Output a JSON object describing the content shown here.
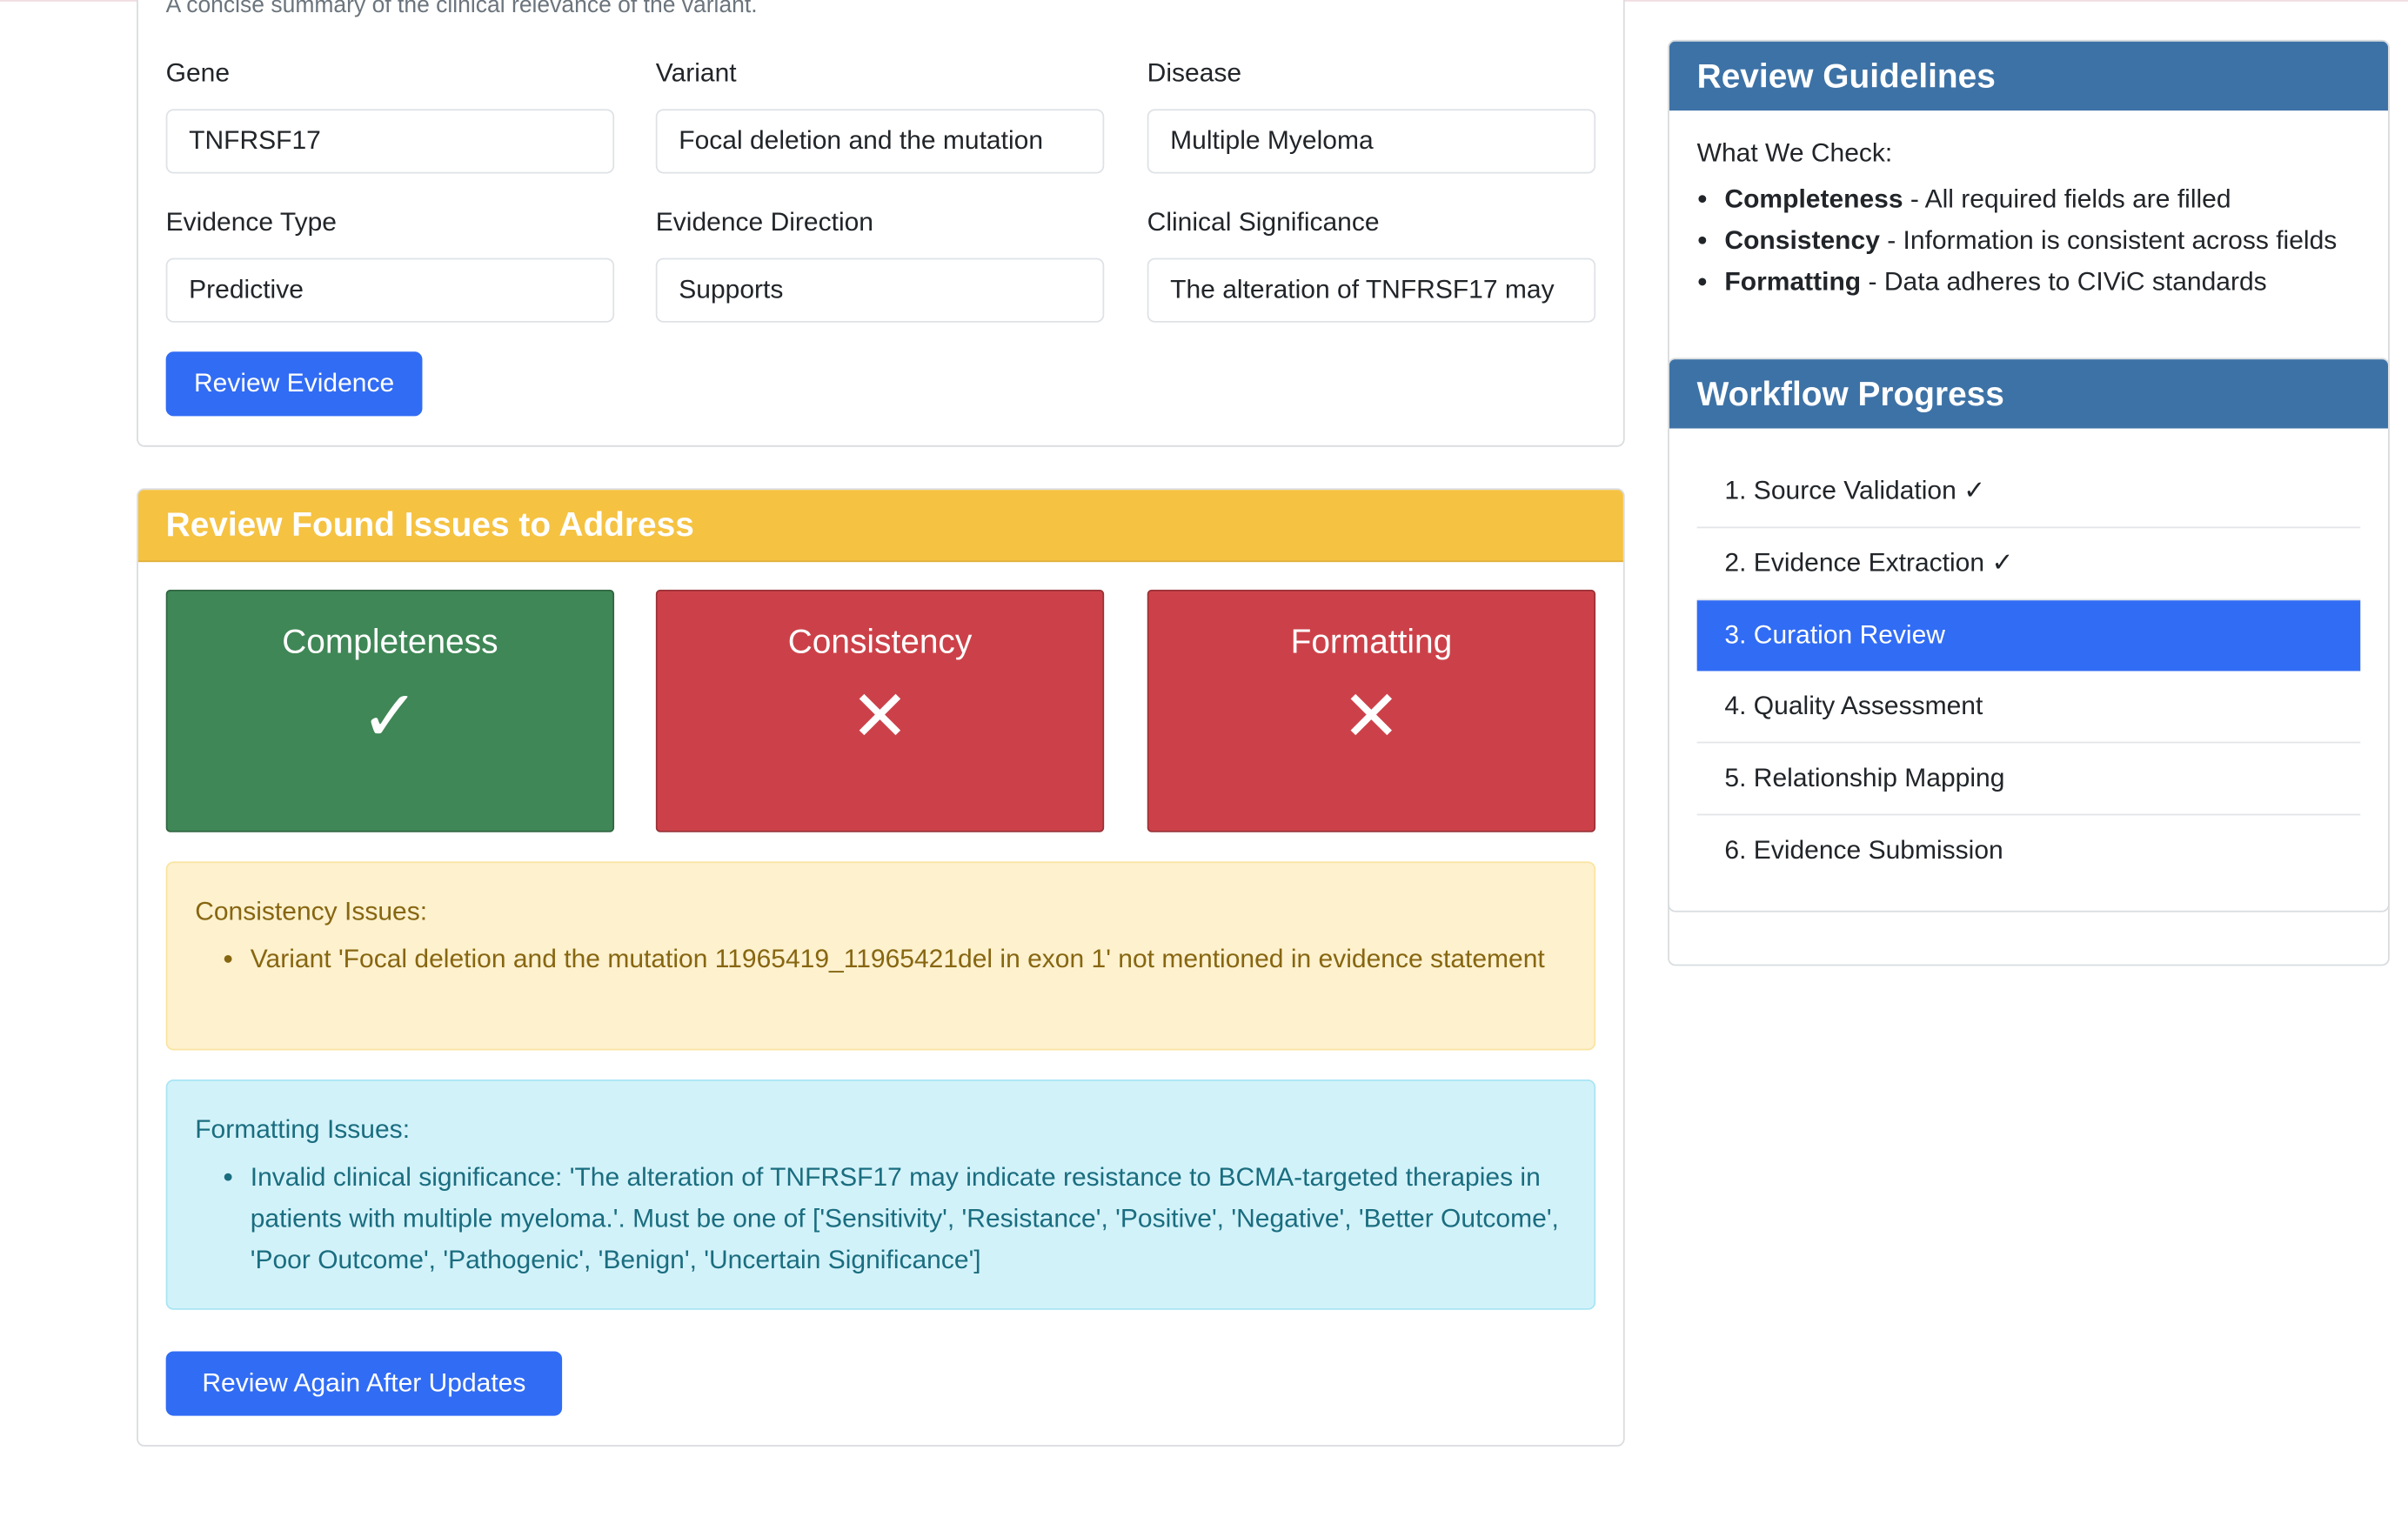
{
  "form": {
    "description": "A concise summary of the clinical relevance of the variant.",
    "fields": [
      {
        "label": "Gene",
        "value": "TNFRSF17"
      },
      {
        "label": "Variant",
        "value": "Focal deletion and the mutation"
      },
      {
        "label": "Disease",
        "value": "Multiple Myeloma"
      },
      {
        "label": "Evidence Type",
        "value": "Predictive"
      },
      {
        "label": "Evidence Direction",
        "value": "Supports"
      },
      {
        "label": "Clinical Significance",
        "value": "The alteration of TNFRSF17 may"
      }
    ],
    "review_button": "Review Evidence"
  },
  "review": {
    "title": "Review Found Issues to Address",
    "checks": [
      {
        "label": "Completeness",
        "icon": "✓",
        "status": "pass",
        "color": "#3f8756"
      },
      {
        "label": "Consistency",
        "icon": "✕",
        "status": "fail",
        "color": "#cc4149"
      },
      {
        "label": "Formatting",
        "icon": "✕",
        "status": "fail",
        "color": "#cc4149"
      }
    ],
    "consistency": {
      "title": "Consistency Issues:",
      "items": [
        "Variant 'Focal deletion and the mutation 11965419_11965421del in exon 1' not mentioned in evidence statement"
      ]
    },
    "formatting": {
      "title": "Formatting Issues:",
      "items": [
        "Invalid clinical significance: 'The alteration of TNFRSF17 may indicate resistance to BCMA-targeted therapies in patients with multiple myeloma.'. Must be one of ['Sensitivity', 'Resistance', 'Positive', 'Negative', 'Better Outcome', 'Poor Outcome', 'Pathogenic', 'Benign', 'Uncertain Significance']"
      ]
    },
    "again_button": "Review Again After Updates"
  },
  "guidelines": {
    "title": "Review Guidelines",
    "subtitle": "What We Check:",
    "items": [
      {
        "term": "Completeness",
        "desc": " - All required fields are filled"
      },
      {
        "term": "Consistency",
        "desc": " - Information is consistent across fields"
      },
      {
        "term": "Formatting",
        "desc": " - Data adheres to CIViC standards"
      }
    ]
  },
  "workflow": {
    "title": "Workflow Progress",
    "steps": [
      "1. Source Validation ✓",
      "2. Evidence Extraction ✓",
      "3. Curation Review",
      "4. Quality Assessment",
      "5. Relationship Mapping",
      "6. Evidence Submission"
    ],
    "active_index": 2
  }
}
